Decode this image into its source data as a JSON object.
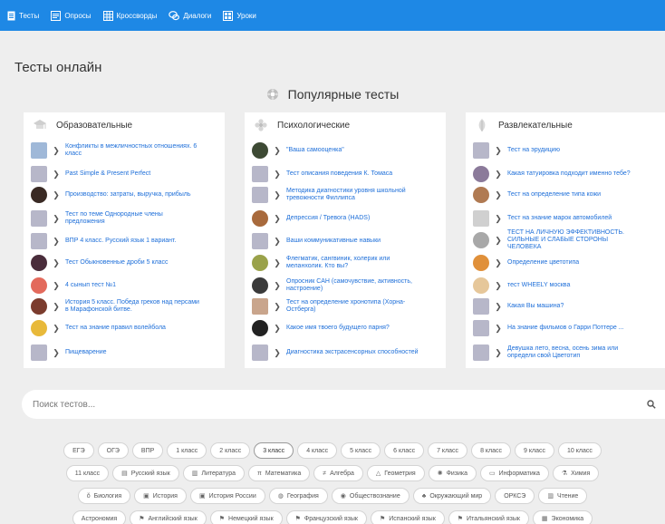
{
  "nav": [
    {
      "label": "Тесты",
      "icon": "doc-icon"
    },
    {
      "label": "Опросы",
      "icon": "list-icon"
    },
    {
      "label": "Кроссворды",
      "icon": "crossword-icon"
    },
    {
      "label": "Диалоги",
      "icon": "dialog-icon"
    },
    {
      "label": "Уроки",
      "icon": "lesson-icon"
    }
  ],
  "page_title": "Тесты онлайн",
  "popular_heading": "Популярные тесты",
  "columns": [
    {
      "title": "Образовательные",
      "items": [
        "Конфликты в межличностных отношениях. 6 класс",
        "Past Simple & Present Perfect",
        "Производство: затраты, выручка, прибыль",
        "Тест по теме Однородные члены предложения",
        "ВПР 4 класс. Русский язык 1 вариант.",
        "Тест Обыкновенные дроби 5 класс",
        "4 сынып тест №1",
        "История 5 класс. Победа греков над персами в Марафонской битве.",
        "Тест на знание правил волейбола",
        "Пищеварение"
      ]
    },
    {
      "title": "Психологические",
      "items": [
        "\"Ваша самооценка\"",
        "Тест описания поведения К. Томаса",
        "Методика диагностики уровня школьной тревожности Филлипса",
        "Депрессия / Тревога (HADS)",
        "Ваши коммуникативные навыки",
        "Флегматик, сангвиник, холерик или меланхолик. Кто вы?",
        "Опросник САН (самочувствие, активность, настроение)",
        "Тест на определение хронотипа (Хорна-Остберга)",
        "Какое имя твоего будущего парня?",
        "Диагностика экстрасенсорных способностей"
      ]
    },
    {
      "title": "Развлекательные",
      "items": [
        "Тест на эрудицию",
        "Какая татуировка подходит именно тебе?",
        "Тест на определение типа кожи",
        "Тест на знание марок автомобилей",
        "ТЕСТ НА ЛИЧНУЮ ЭФФЕКТИВНОСТЬ. СИЛЬНЫЕ И СЛАБЫЕ СТОРОНЫ ЧЕЛОВЕКА",
        "Определение цветотипа",
        "тест WHEELY москва",
        "Какая Вы машина?",
        "На знание фильмов о Гарри Поттере ...",
        "Девушка лето, весна, осень зима или определи свой Цветотип"
      ]
    }
  ],
  "search": {
    "placeholder": "Поиск тестов..."
  },
  "tags": [
    [
      "ЕГЭ",
      "ОГЭ",
      "ВПР",
      "1 класс",
      "2 класс",
      "3 класс",
      "4 класс",
      "5 класс",
      "6 класс",
      "7 класс",
      "8 класс",
      "9 класс",
      "10 класс"
    ],
    [
      "11 класс",
      "Русский язык",
      "Литература",
      "Математика",
      "Алгебра",
      "Геометрия",
      "Физика",
      "Информатика",
      "Химия"
    ],
    [
      "Биология",
      "История",
      "История России",
      "География",
      "Обществознание",
      "Окружающий мир",
      "ОРКСЭ",
      "Чтение"
    ],
    [
      "Астрономия",
      "Английский язык",
      "Немецкий язык",
      "Французский язык",
      "Испанский язык",
      "Итальянский язык",
      "Экономика"
    ]
  ],
  "active_tag": "3 класс",
  "colors": {
    "accent": "#1e88e5",
    "link": "#1e6fd9",
    "background": "#eeeeee"
  }
}
